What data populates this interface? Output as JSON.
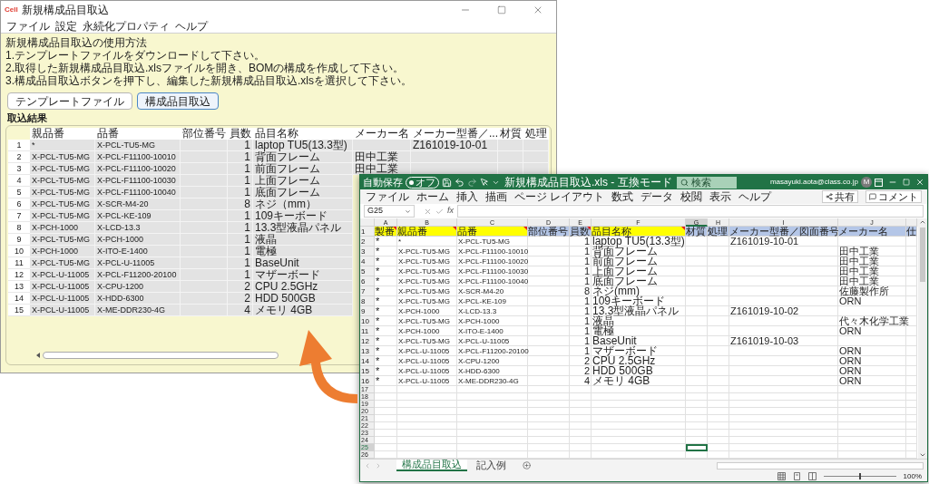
{
  "app_window": {
    "icon_text": "Cell",
    "title": "新規構成品目取込",
    "menu": [
      "ファイル",
      "設定",
      "永続化プロパティ",
      "ヘルプ"
    ],
    "instructions": [
      "新規構成品目取込の使用方法",
      "1.テンプレートファイルをダウンロードして下さい。",
      "2.取得した新規構成品目取込.xlsファイルを開き、BOMの構成を作成して下さい。",
      "3.構成品目取込ボタンを押下し、編集した新規構成品目取込.xlsを選択して下さい。"
    ],
    "buttons": [
      {
        "label": "テンプレートファイル",
        "focused": false
      },
      {
        "label": "構成品目取込",
        "focused": true
      }
    ],
    "result_label": "取込結果",
    "table": {
      "columns": [
        "親品番",
        "品番",
        "部位番号",
        "員数",
        "品目名称",
        "メーカー名",
        "メーカー型番／...",
        "材質",
        "処理"
      ],
      "rows": [
        {
          "number": "1",
          "cells": [
            "*",
            "X-PCL-TU5-MG",
            null,
            "1",
            "laptop TU5(13.3型)",
            null,
            "Z161019-10-01"
          ]
        },
        {
          "number": "2",
          "cells": [
            "X-PCL-TU5-MG",
            "X-PCL-F11100-10010",
            null,
            "1",
            "背面フレーム",
            "田中工業"
          ]
        },
        {
          "number": "3",
          "cells": [
            "X-PCL-TU5-MG",
            "X-PCL-F11100-10020",
            null,
            "1",
            "前面フレーム",
            "田中工業"
          ]
        },
        {
          "number": "4",
          "cells": [
            "X-PCL-TU5-MG",
            "X-PCL-F11100-10030",
            null,
            "1",
            "上面フレーム"
          ]
        },
        {
          "number": "5",
          "cells": [
            "X-PCL-TU5-MG",
            "X-PCL-F11100-10040",
            null,
            "1",
            "底面フレーム"
          ]
        },
        {
          "number": "6",
          "cells": [
            "X-PCL-TU5-MG",
            "X-SCR-M4-20",
            null,
            "8",
            "ネジ（mm）"
          ]
        },
        {
          "number": "7",
          "cells": [
            "X-PCL-TU5-MG",
            "X-PCL-KE-109",
            null,
            "1",
            "109キーボード"
          ]
        },
        {
          "number": "8",
          "cells": [
            "X-PCH-1000",
            "X-LCD-13.3",
            null,
            "1",
            "13.3型液晶パネル"
          ]
        },
        {
          "number": "9",
          "cells": [
            "X-PCL-TU5-MG",
            "X-PCH-1000",
            null,
            "1",
            "液晶"
          ]
        },
        {
          "number": "10",
          "cells": [
            "X-PCH-1000",
            "X-ITO-E-1400",
            null,
            "1",
            "電極"
          ]
        },
        {
          "number": "11",
          "cells": [
            "X-PCL-TU5-MG",
            "X-PCL-U-11005",
            null,
            "1",
            "BaseUnit"
          ]
        },
        {
          "number": "12",
          "cells": [
            "X-PCL-U-11005",
            "X-PCL-F11200-20100",
            null,
            "1",
            "マザーボード"
          ]
        },
        {
          "number": "13",
          "cells": [
            "X-PCL-U-11005",
            "X-CPU-1200",
            null,
            "2",
            "CPU 2.5GHz"
          ]
        },
        {
          "number": "14",
          "cells": [
            "X-PCL-U-11005",
            "X-HDD-6300",
            null,
            "2",
            "HDD 500GB"
          ]
        },
        {
          "number": "15",
          "cells": [
            "X-PCL-U-11005",
            "X-ME-DDR230-4G",
            null,
            "4",
            "メモリ 4GB"
          ]
        }
      ]
    }
  },
  "excel": {
    "autosave_label": "自動保存",
    "autosave": {
      "on": false,
      "label": "オフ"
    },
    "file_title": "新規構成品目取込.xls - 互換モード",
    "search_placeholder": "検索",
    "account": "masayuki.aota@class.co.jp",
    "avatar": "M",
    "ribbon_tabs": [
      "ファイル",
      "ホーム",
      "挿入",
      "描画",
      "ページ レイアウト",
      "数式",
      "データ",
      "校閲",
      "表示",
      "ヘルプ"
    ],
    "share_button": "共有",
    "comment_button": "コメント",
    "name_box": "G25",
    "function_symbol": "fx",
    "columns": [
      {
        "letter": "A",
        "selected": false
      },
      {
        "letter": "B",
        "selected": false
      },
      {
        "letter": "C",
        "selected": false
      },
      {
        "letter": "D",
        "selected": false
      },
      {
        "letter": "E",
        "selected": false
      },
      {
        "letter": "F",
        "selected": false
      },
      {
        "letter": "G",
        "selected": true
      },
      {
        "letter": "H",
        "selected": false
      },
      {
        "letter": "I",
        "selected": false
      },
      {
        "letter": "J",
        "selected": false
      },
      {
        "selected": false
      }
    ],
    "header_row": {
      "number": "1",
      "selected": false,
      "cells": [
        {
          "text": "製番",
          "color": "#ffff00",
          "comment": true
        },
        {
          "text": "親品番",
          "color": "#ffff00",
          "comment": true
        },
        {
          "text": "品番",
          "color": "#ffff00",
          "comment": true
        },
        {
          "text": "部位番号",
          "color": "#b4c6e7",
          "comment": false
        },
        {
          "text": "員数",
          "color": "#b4c6e7",
          "comment": true
        },
        {
          "text": "品目名称",
          "color": "#ffff00",
          "comment": true
        },
        {
          "text": "材質",
          "color": "#b4c6e7",
          "comment": false
        },
        {
          "text": "処理",
          "color": "#b4c6e7",
          "comment": false
        },
        {
          "text": "メーカー型番／図面番号",
          "color": "#b4c6e7",
          "comment": false
        },
        {
          "text": "メーカー名",
          "color": "#b4c6e7",
          "comment": false
        },
        {
          "text": "仕",
          "color": "#b4c6e7",
          "comment": false
        }
      ]
    },
    "rows": [
      {
        "number": "2",
        "selected": false,
        "cells": [
          "*",
          "*",
          "X-PCL-TU5-MG",
          null,
          "1",
          "laptop TU5(13.3型)",
          null,
          null,
          "Z161019-10-01"
        ]
      },
      {
        "number": "3",
        "selected": false,
        "cells": [
          "*",
          "X-PCL-TU5-MG",
          "X-PCL-F11100-10010",
          null,
          "1",
          "背面フレーム",
          null,
          null,
          null,
          "田中工業"
        ]
      },
      {
        "number": "4",
        "selected": false,
        "cells": [
          "*",
          "X-PCL-TU5-MG",
          "X-PCL-F11100-10020",
          null,
          "1",
          "前面フレーム",
          null,
          null,
          null,
          "田中工業"
        ]
      },
      {
        "number": "5",
        "selected": false,
        "cells": [
          "*",
          "X-PCL-TU5-MG",
          "X-PCL-F11100-10030",
          null,
          "1",
          "上面フレーム",
          null,
          null,
          null,
          "田中工業"
        ]
      },
      {
        "number": "6",
        "selected": false,
        "cells": [
          "*",
          "X-PCL-TU5-MG",
          "X-PCL-F11100-10040",
          null,
          "1",
          "底面フレーム",
          null,
          null,
          null,
          "田中工業"
        ]
      },
      {
        "number": "7",
        "selected": false,
        "cells": [
          "*",
          "X-PCL-TU5-MG",
          "X-SCR-M4-20",
          null,
          "8",
          "ネジ(mm)",
          null,
          null,
          null,
          "佐藤製作所"
        ]
      },
      {
        "number": "8",
        "selected": false,
        "cells": [
          "*",
          "X-PCL-TU5-MG",
          "X-PCL-KE-109",
          null,
          "1",
          "109キーボード",
          null,
          null,
          null,
          "ORN"
        ]
      },
      {
        "number": "9",
        "selected": false,
        "cells": [
          "*",
          "X-PCH-1000",
          "X-LCD-13.3",
          null,
          "1",
          "13.3型液晶パネル",
          null,
          null,
          "Z161019-10-02"
        ]
      },
      {
        "number": "10",
        "selected": false,
        "cells": [
          "*",
          "X-PCL-TU5-MG",
          "X-PCH-1000",
          null,
          "1",
          "液晶",
          null,
          null,
          null,
          "代々木化学工業"
        ]
      },
      {
        "number": "11",
        "selected": false,
        "cells": [
          "*",
          "X-PCH-1000",
          "X-ITO-E-1400",
          null,
          "1",
          "電極",
          null,
          null,
          null,
          "ORN"
        ]
      },
      {
        "number": "12",
        "selected": false,
        "cells": [
          "*",
          "X-PCL-TU5-MG",
          "X-PCL-U-11005",
          null,
          "1",
          "BaseUnit",
          null,
          null,
          "Z161019-10-03"
        ]
      },
      {
        "number": "13",
        "selected": false,
        "cells": [
          "*",
          "X-PCL-U-11005",
          "X-PCL-F11200-20100",
          null,
          "1",
          "マザーボード",
          null,
          null,
          null,
          "ORN"
        ]
      },
      {
        "number": "14",
        "selected": false,
        "cells": [
          "*",
          "X-PCL-U-11005",
          "X-CPU-1200",
          null,
          "2",
          "CPU 2.5GHz",
          null,
          null,
          null,
          "ORN"
        ]
      },
      {
        "number": "15",
        "selected": false,
        "cells": [
          "*",
          "X-PCL-U-11005",
          "X-HDD-6300",
          null,
          "2",
          "HDD 500GB",
          null,
          null,
          null,
          "ORN"
        ]
      },
      {
        "number": "16",
        "selected": false,
        "cells": [
          "*",
          "X-PCL-U-11005",
          "X-ME-DDR230-4G",
          null,
          "4",
          "メモリ 4GB",
          null,
          null,
          null,
          "ORN"
        ]
      },
      {
        "number": "17",
        "selected": false
      },
      {
        "number": "18",
        "selected": false
      },
      {
        "number": "19",
        "selected": false
      },
      {
        "number": "20",
        "selected": false
      },
      {
        "number": "21",
        "selected": false
      },
      {
        "number": "22",
        "selected": false
      },
      {
        "number": "23",
        "selected": false
      },
      {
        "number": "24",
        "selected": false
      },
      {
        "number": "25",
        "selected": true
      },
      {
        "number": "26",
        "selected": false
      }
    ],
    "sheet_tabs": [
      {
        "label": "構成品目取込",
        "selected": true
      },
      {
        "label": "記入例",
        "selected": false
      }
    ],
    "zoom_slider": {
      "level": 0.5
    },
    "zoom": "100%"
  }
}
